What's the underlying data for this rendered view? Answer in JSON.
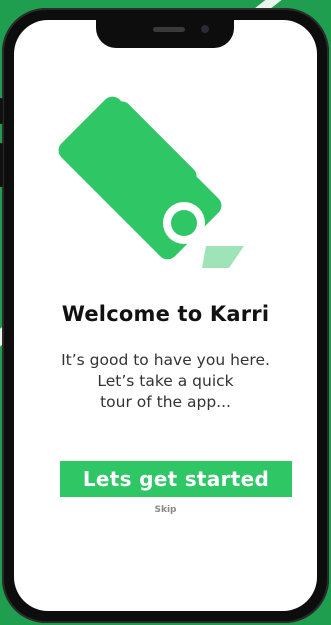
{
  "welcome": {
    "title": "Welcome to Karri",
    "subtitle_lines": [
      "It’s good to have you here.",
      "Let’s take a quick",
      "tour of the app..."
    ]
  },
  "actions": {
    "primary_label": "Lets get started",
    "skip_label": "Skip"
  },
  "colors": {
    "brand_green": "#2fc766",
    "brand_green_light": "#9fe3b8",
    "background_green": "#1f9e4f"
  },
  "icons": {
    "logo": "karri-logo-icon"
  }
}
